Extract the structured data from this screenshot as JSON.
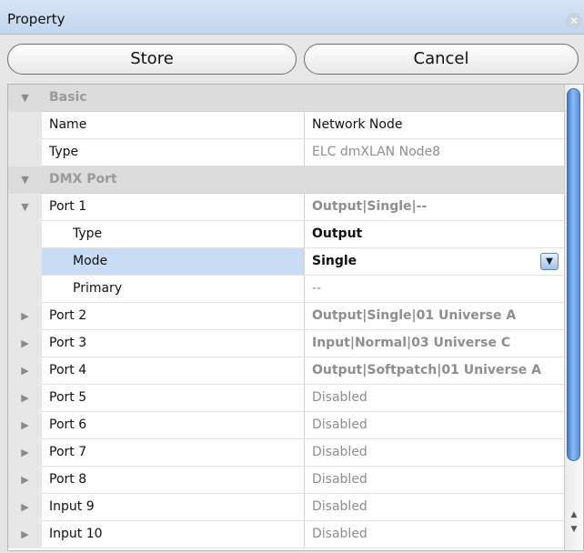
{
  "window": {
    "title": "Property"
  },
  "toolbar": {
    "store_label": "Store",
    "cancel_label": "Cancel"
  },
  "icons": {
    "close": "close-circle-icon",
    "expanded": "triangle-down-icon",
    "collapsed": "triangle-right-icon",
    "dropdown": "dropdown-arrow-icon"
  },
  "glyphs": {
    "down": "▼",
    "right": "▶",
    "close": "✕",
    "dd": "▾",
    "up": "▲"
  },
  "rows": {
    "basic": "Basic",
    "name": {
      "label": "Name",
      "value": "Network Node"
    },
    "type": {
      "label": "Type",
      "value": "ELC dmXLAN Node8"
    },
    "dmx_port": "DMX Port",
    "port1": {
      "label": "Port 1",
      "value": "Output|Single|--"
    },
    "port1_type": {
      "label": "Type",
      "value": "Output"
    },
    "port1_mode": {
      "label": "Mode",
      "value": "Single"
    },
    "port1_primary": {
      "label": "Primary",
      "value": "--"
    },
    "port2": {
      "label": "Port 2",
      "value": "Output|Single|01 Universe A"
    },
    "port3": {
      "label": "Port 3",
      "value": "Input|Normal|03 Universe C"
    },
    "port4": {
      "label": "Port 4",
      "value": "Output|Softpatch|01 Universe A"
    },
    "port5": {
      "label": "Port 5",
      "value": "Disabled"
    },
    "port6": {
      "label": "Port 6",
      "value": "Disabled"
    },
    "port7": {
      "label": "Port 7",
      "value": "Disabled"
    },
    "port8": {
      "label": "Port 8",
      "value": "Disabled"
    },
    "input9": {
      "label": "Input 9",
      "value": "Disabled"
    },
    "input10": {
      "label": "Input 10",
      "value": "Disabled"
    }
  }
}
